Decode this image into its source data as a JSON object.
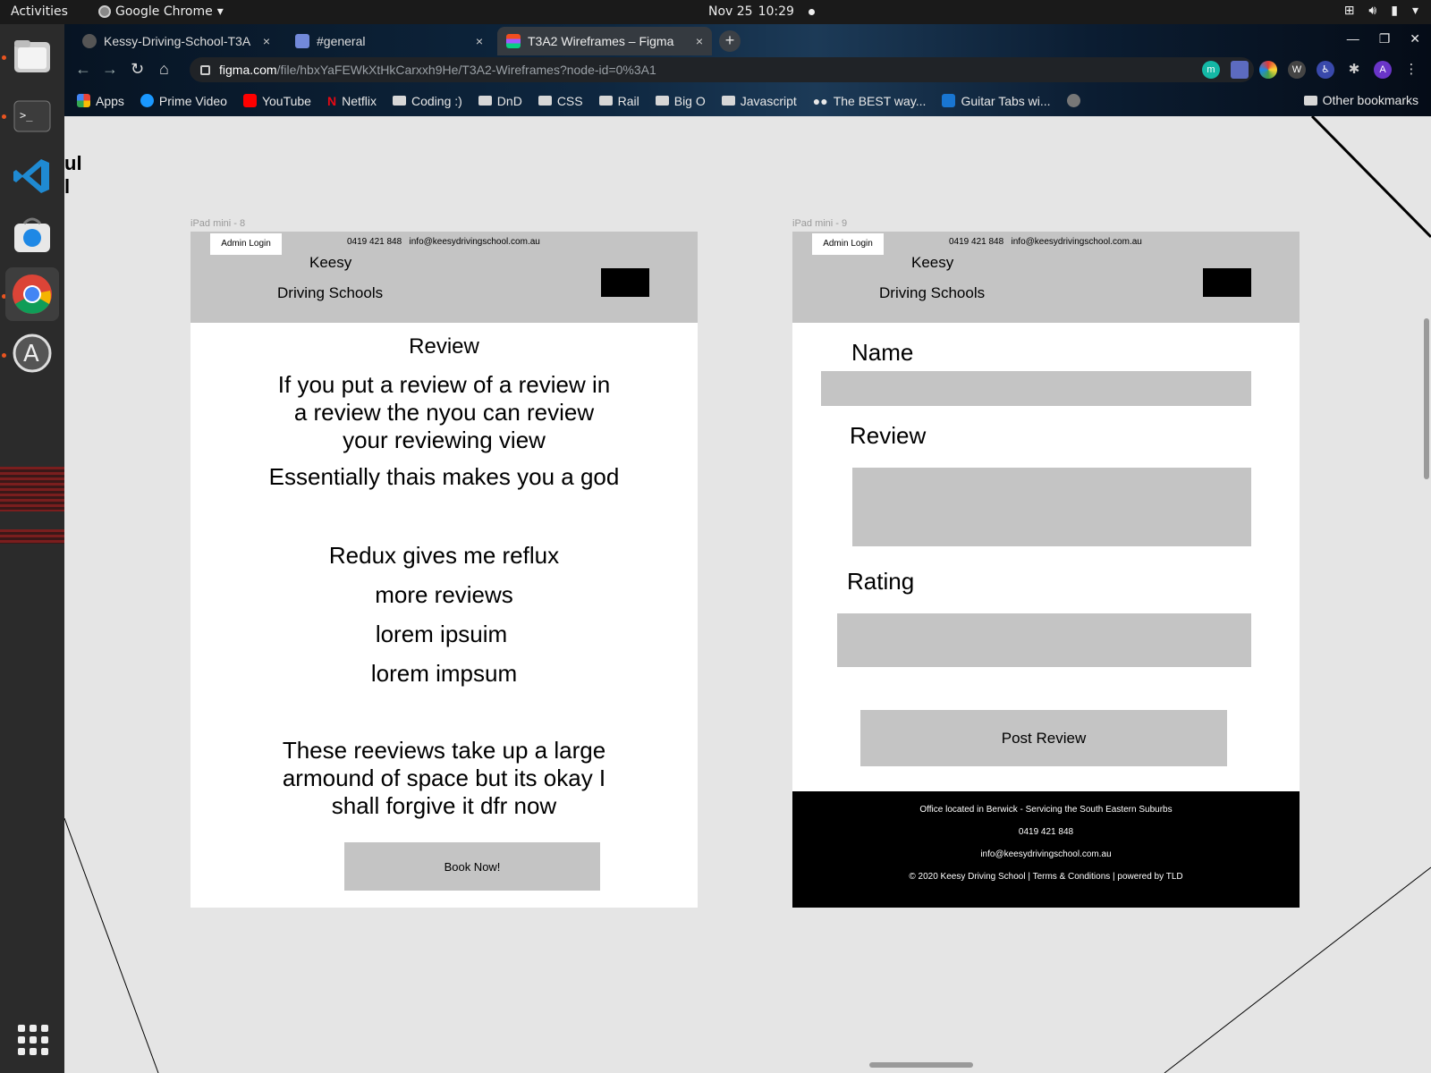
{
  "topbar": {
    "activities": "Activities",
    "app_name": "Google Chrome",
    "date": "Nov 25",
    "time": "10:29"
  },
  "tabs": [
    {
      "title": "Kessy-Driving-School-T3A",
      "close": "×",
      "icon": "github-icon"
    },
    {
      "title": "#general",
      "close": "×",
      "icon": "discord-icon"
    },
    {
      "title": "T3A2 Wireframes – Figma",
      "close": "×",
      "icon": "figma-icon"
    }
  ],
  "new_tab": "+",
  "omnibox": {
    "host": "figma.com",
    "path": "/file/hbxYaFEWkXtHkCarxxh9He/T3A2-Wireframes?node-id=0%3A1"
  },
  "bookmarks": [
    {
      "label": "Apps",
      "icon": "apps-grid-icon"
    },
    {
      "label": "Prime Video",
      "icon": "prime-video-icon"
    },
    {
      "label": "YouTube",
      "icon": "youtube-icon"
    },
    {
      "label": "Netflix",
      "icon": "netflix-icon"
    },
    {
      "label": "Coding :)",
      "icon": "folder-icon"
    },
    {
      "label": "DnD",
      "icon": "folder-icon"
    },
    {
      "label": "CSS",
      "icon": "folder-icon"
    },
    {
      "label": "Rail",
      "icon": "folder-icon"
    },
    {
      "label": "Big O",
      "icon": "folder-icon"
    },
    {
      "label": "Javascript",
      "icon": "folder-icon"
    },
    {
      "label": "The BEST way...",
      "icon": "medium-icon"
    },
    {
      "label": "Guitar Tabs wi...",
      "icon": "guitar-tabs-icon"
    }
  ],
  "other_bookmarks": "Other bookmarks",
  "profile_initial": "A",
  "colors": {
    "wire_gray": "#c4c4c4",
    "canvas_bg": "#e5e5e5",
    "dock_accent": "#e95420"
  },
  "frame8": {
    "label": "iPad mini - 8",
    "admin_login": "Admin Login",
    "phone": "0419 421 848",
    "email": "info@keesydrivingschool.com.au",
    "brand_line1": "Keesy",
    "brand_line2": "Driving Schools",
    "heading": "Review",
    "review1": "If you put a review of a review in a review the nyou can review your reviewing view",
    "review2": "Essentially thais makes you a god",
    "review3": "Redux gives me reflux",
    "review4": "more reviews",
    "review5": "lorem ipsuim",
    "review6": "lorem impsum",
    "review7": "These reeviews take up a large armound of space but its okay I shall forgive it dfr now",
    "book_now": "Book Now!"
  },
  "frame9": {
    "label": "iPad mini - 9",
    "admin_login": "Admin Login",
    "phone": "0419 421 848",
    "email": "info@keesydrivingschool.com.au",
    "brand_line1": "Keesy",
    "brand_line2": "Driving Schools",
    "name_label": "Name",
    "review_label": "Review",
    "rating_label": "Rating",
    "post_review": "Post Review",
    "footer_office": "Office located in Berwick - Servicing the South Eastern Suburbs",
    "footer_phone": "0419 421 848",
    "footer_email": "info@keesydrivingschool.com.au",
    "footer_copyright": "© 2020 Keesy Driving School | Terms & Conditions | powered by TLD"
  }
}
